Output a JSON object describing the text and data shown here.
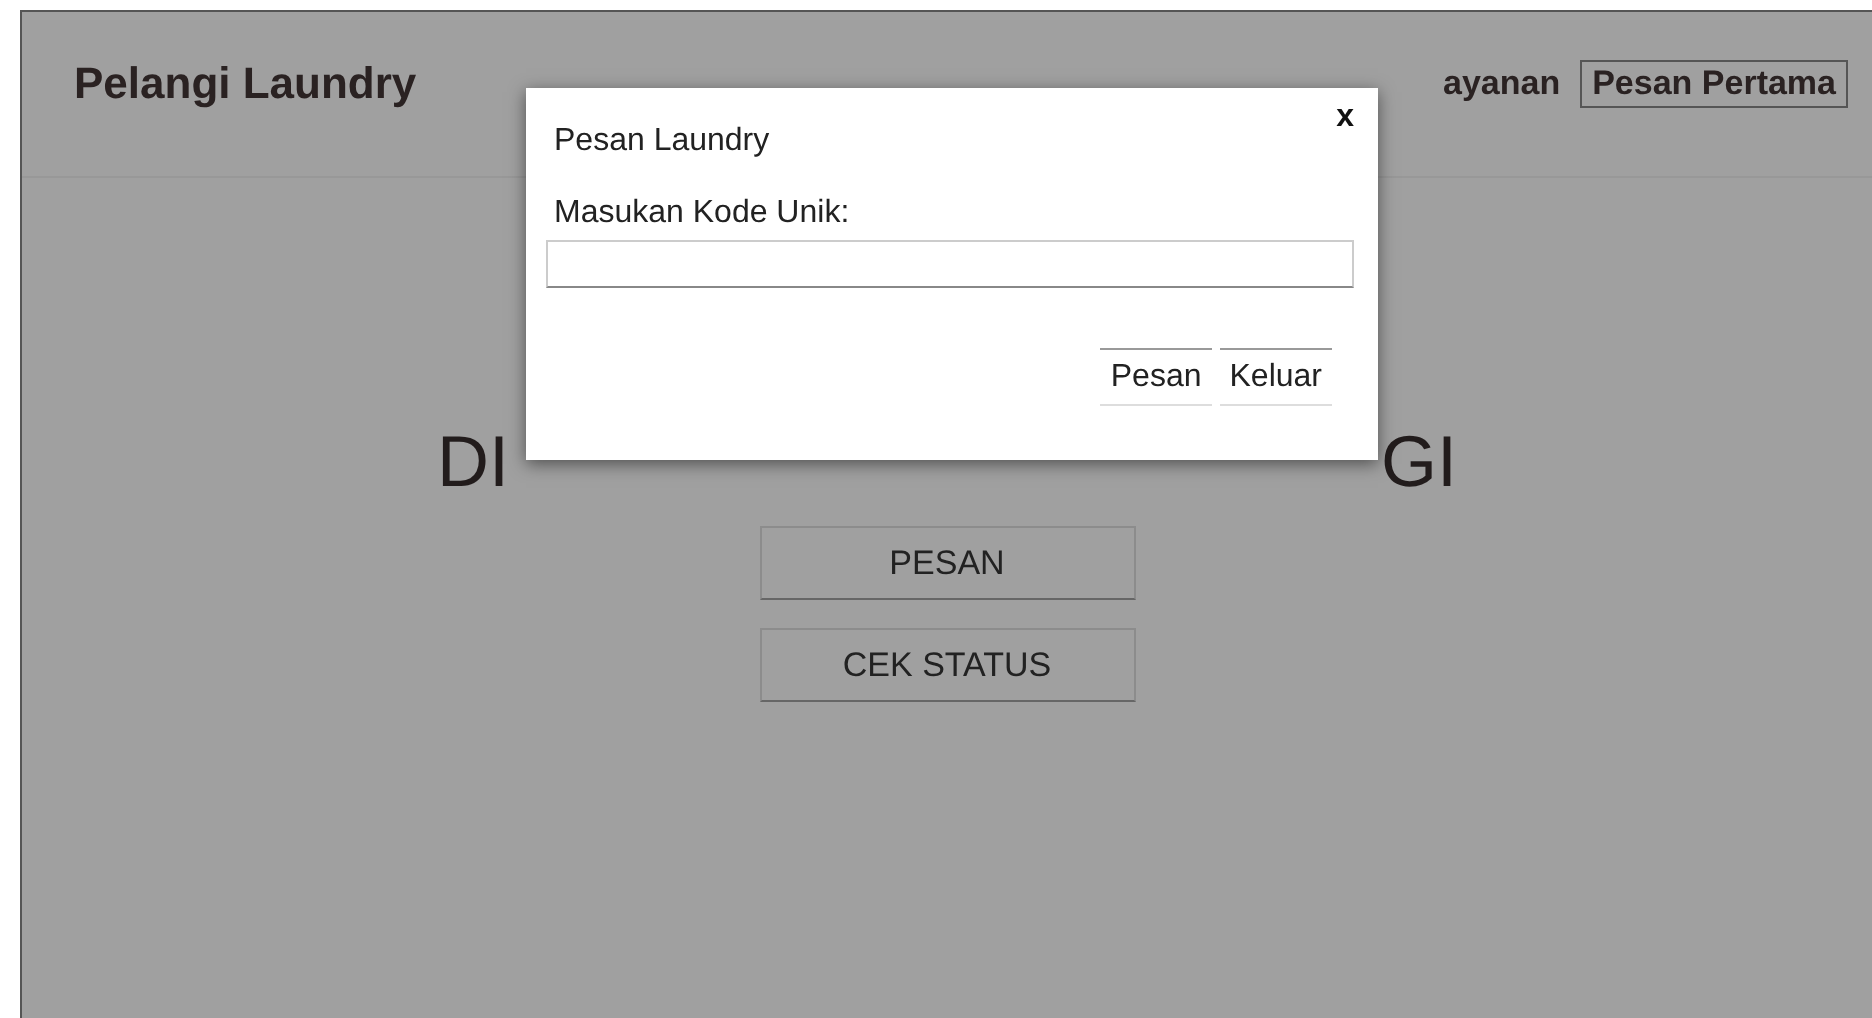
{
  "header": {
    "brand": "Pelangi Laundry",
    "nav": [
      {
        "label": "ayanan",
        "selected": false
      },
      {
        "label": "Pesan Pertama",
        "selected": true
      }
    ]
  },
  "main": {
    "heading_parts": [
      "DI",
      "GI"
    ],
    "buttons": [
      "PESAN",
      "CEK STATUS"
    ]
  },
  "modal": {
    "title": "Pesan Laundry",
    "close": "x",
    "field_label": "Masukan Kode Unik:",
    "buttons": [
      "Pesan",
      "Keluar"
    ]
  }
}
